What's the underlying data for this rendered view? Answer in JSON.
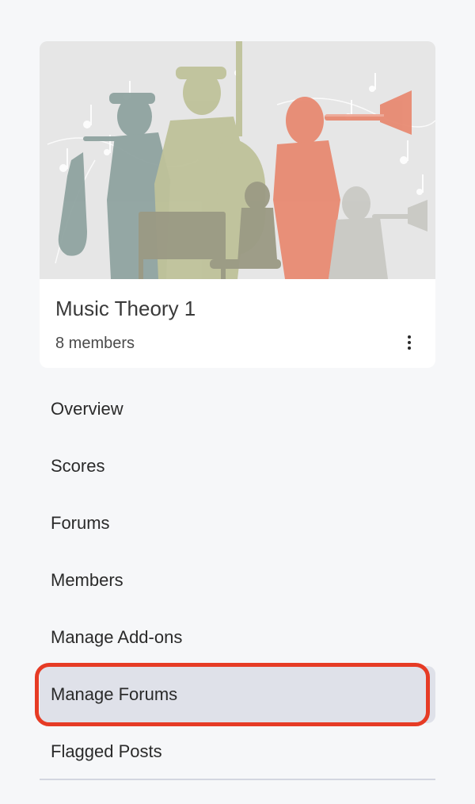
{
  "group": {
    "title": "Music Theory 1",
    "members": "8 members",
    "more_icon": "kebab-menu-icon"
  },
  "nav": {
    "items": [
      {
        "label": "Overview"
      },
      {
        "label": "Scores"
      },
      {
        "label": "Forums"
      },
      {
        "label": "Members"
      },
      {
        "label": "Manage Add-ons"
      },
      {
        "label": "Manage Forums",
        "active": true,
        "highlighted": true
      },
      {
        "label": "Flagged Posts"
      }
    ]
  },
  "colors": {
    "background": "#f6f7f9",
    "card": "#ffffff",
    "active_item": "#dfe1e9",
    "highlight": "#e63b25",
    "divider": "#d3d6e0"
  }
}
